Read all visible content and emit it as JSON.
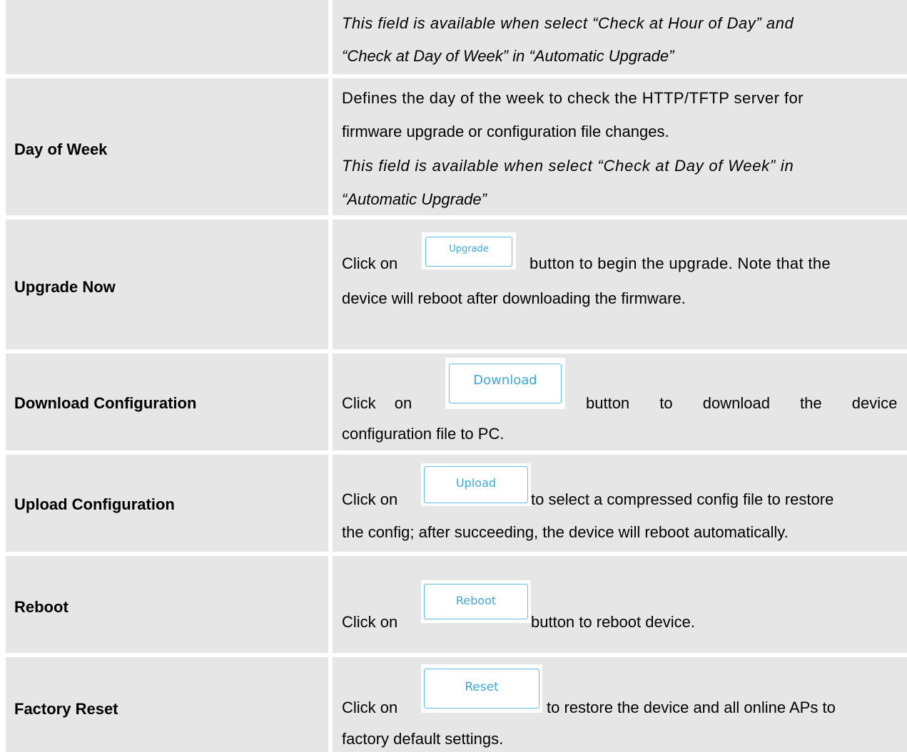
{
  "rows": [
    {
      "label": "",
      "italic_lines": [
        "This field is available when select “Check at Hour of Day” and",
        "“Check at Day of Week” in “Automatic Upgrade”"
      ]
    },
    {
      "label": "Day of Week",
      "text_lines": [
        "Defines the day of the week to check the HTTP/TFTP server for",
        "firmware upgrade or configuration file changes."
      ],
      "italic_lines": [
        "This field is available when select “Check at Day of Week” in",
        "“Automatic Upgrade”"
      ]
    },
    {
      "label": "Upgrade Now",
      "before": "Click on",
      "button": "Upgrade",
      "after": "button to begin the upgrade. Note that the",
      "line2": "device will reboot after downloading the firmware."
    },
    {
      "label": "Download Configuration",
      "before": "Click on",
      "button": "Download",
      "after": "button to download the device",
      "line2": "configuration file to PC."
    },
    {
      "label": "Upload Configuration",
      "before": "Click on",
      "button": "Upload",
      "after": "to select a compressed config file to restore",
      "line2": "the config; after succeeding, the device will reboot automatically."
    },
    {
      "label": "Reboot",
      "before": "Click on",
      "button": "Reboot",
      "after": "button to reboot device."
    },
    {
      "label": "Factory Reset",
      "before": "Click on",
      "button": "Reset",
      "after": "to restore the device and all online APs to",
      "line2": "factory default settings."
    }
  ]
}
